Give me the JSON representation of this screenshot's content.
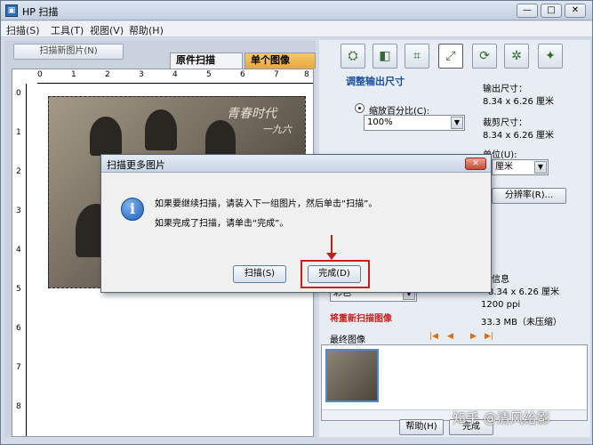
{
  "window": {
    "title": "HP 扫描",
    "min_label": "—",
    "max_label": "□",
    "close_label": "✕"
  },
  "menu": [
    "扫描(S)",
    "工具(T)",
    "视图(V)",
    "帮助(H)"
  ],
  "left": {
    "scan_new_label": "扫描新图片(N)",
    "tabs": [
      "原件扫描",
      "单个图像"
    ],
    "ruler_top": [
      "0",
      "1",
      "2",
      "3",
      "4",
      "5",
      "6",
      "7",
      "8"
    ],
    "ruler_left": [
      "0",
      "1",
      "2",
      "3",
      "4",
      "5",
      "6",
      "7",
      "8"
    ],
    "photo_caption": [
      "青春时代",
      "一九六"
    ]
  },
  "right": {
    "section_title": "调整输出尺寸",
    "scale_label": "缩放百分比(C):",
    "scale_value": "100%",
    "output_size_label": "输出尺寸：",
    "output_size_value": "8.34 x 6.26 厘米",
    "crop_size_label": "裁剪尺寸：",
    "crop_size_value": "8.34 x 6.26 厘米",
    "unit_label": "单位(U):",
    "unit_value": "厘米",
    "resolution_btn": "分辨率(R)...",
    "info_label": "信息",
    "info_size": "8.34 x 6.26 厘米",
    "info_ppi": "1200 ppi",
    "info_mb": "33.3 MB（未压缩）",
    "color_value": "彩色",
    "rescan_text": "将重新扫描图像",
    "final_image_label": "最终图像",
    "help_btn": "帮助(H)",
    "done_btn_partial": "完成"
  },
  "dialog": {
    "title": "扫描更多图片",
    "close_label": "✕",
    "msg1": "如果要继续扫描，请装入下一组图片，然后单击“扫描”。",
    "msg2": "如果完成了扫描，请单击“完成”。",
    "scan_btn": "扫描(S)",
    "done_btn": "完成(D)"
  },
  "watermark": "知乎 @清风给影",
  "colors": {
    "accent": "#1a4fa0",
    "highlight": "#d11a1a",
    "tab_active": "#e6a940"
  }
}
